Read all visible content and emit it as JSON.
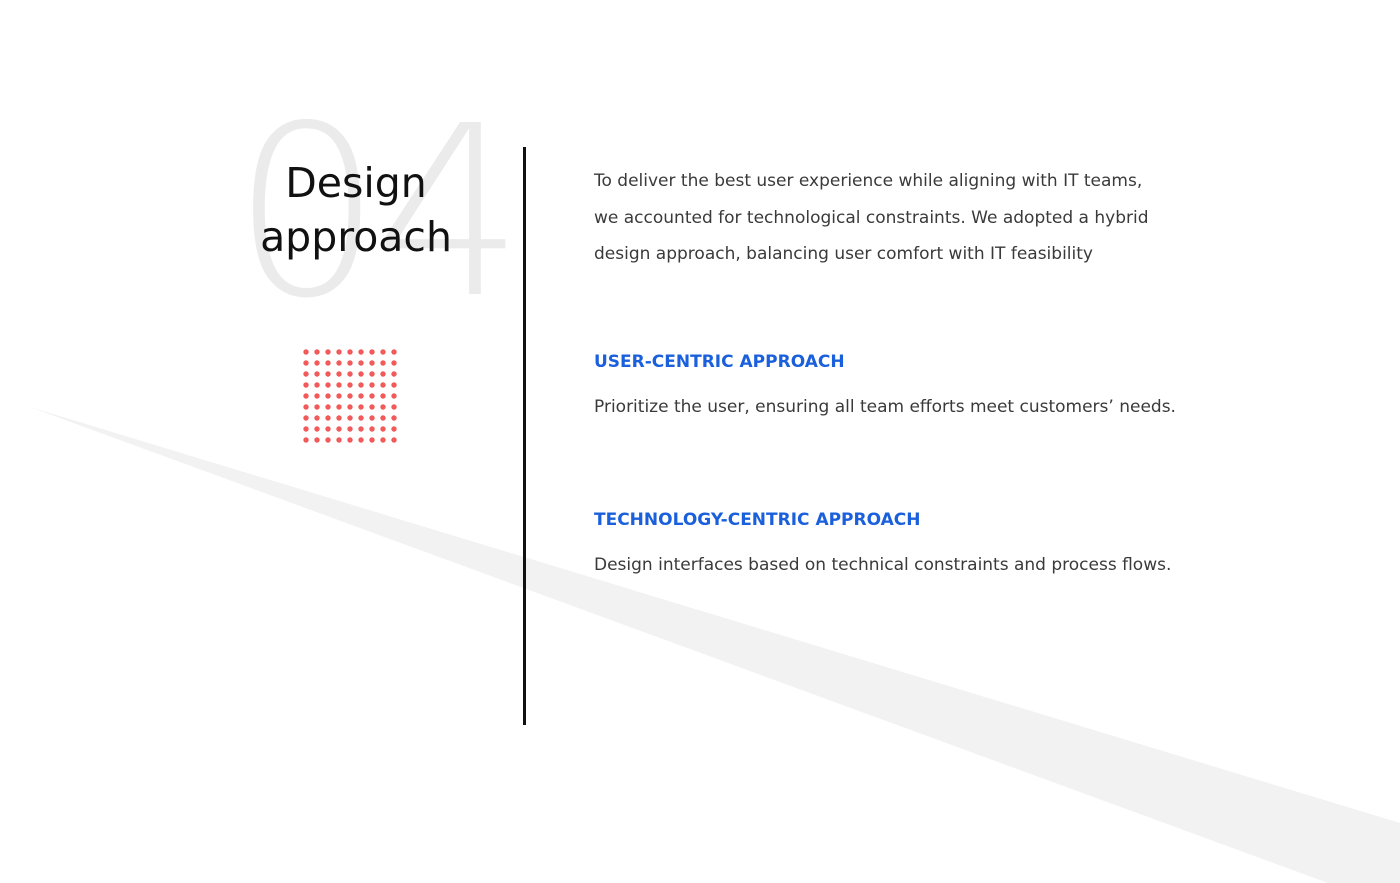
{
  "section": {
    "number": "04",
    "title": "Design\napproach"
  },
  "intro": {
    "lines": [
      "To deliver the best user experience while aligning with IT teams,",
      "we accounted for technological constraints. We adopted a hybrid",
      "design approach, balancing user comfort with IT feasibility"
    ]
  },
  "approaches": [
    {
      "heading": "USER-CENTRIC APPROACH",
      "description": "Prioritize the user, ensuring all team efforts meet customers’ needs."
    },
    {
      "heading": "TECHNOLOGY-CENTRIC APPROACH",
      "description": "Design interfaces based on technical constraints and process flows."
    }
  ],
  "colors": {
    "accent_blue": "#1a5fdb",
    "dot_red": "#f25a5a",
    "divider": "#111111",
    "stripe": "#f2f2f2",
    "number_watermark": "#ebebeb"
  },
  "decorations": {
    "dot_grid": {
      "rows": 9,
      "cols": 9
    }
  }
}
